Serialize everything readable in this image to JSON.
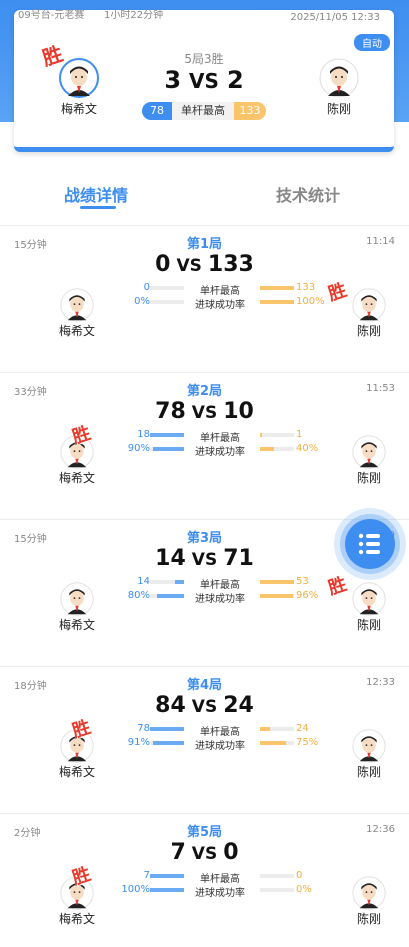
{
  "header": {
    "room": "09号台-元老赛",
    "duration": "1小时22分钟",
    "date": "2025/11/05 12:33",
    "mode_badge": "自动",
    "format": "5局3胜",
    "score_left": "3",
    "vs": "VS",
    "score_right": "2",
    "high_break_label": "单杆最高",
    "high_break_left": "78",
    "high_break_right": "133",
    "winner_mark": "胜",
    "player_left": "梅希文",
    "player_right": "陈刚"
  },
  "tabs": [
    {
      "label": "战绩详情",
      "active": true
    },
    {
      "label": "技术统计",
      "active": false
    }
  ],
  "stat_labels": {
    "high_break": "单杆最高",
    "success_rate": "进球成功率"
  },
  "rounds": [
    {
      "title": "第1局",
      "duration": "15分钟",
      "time": "11:14",
      "left_score": "0",
      "right_score": "133",
      "winner": "right",
      "left_break": "0",
      "right_break": "133",
      "left_rate": "0%",
      "right_rate": "100%"
    },
    {
      "title": "第2局",
      "duration": "33分钟",
      "time": "11:53",
      "left_score": "78",
      "right_score": "10",
      "winner": "left",
      "left_break": "18",
      "right_break": "1",
      "left_rate": "90%",
      "right_rate": "40%"
    },
    {
      "title": "第3局",
      "duration": "15分钟",
      "time": "12:09",
      "left_score": "14",
      "right_score": "71",
      "winner": "right",
      "left_break": "14",
      "right_break": "53",
      "left_rate": "80%",
      "right_rate": "96%"
    },
    {
      "title": "第4局",
      "duration": "18分钟",
      "time": "12:33",
      "left_score": "84",
      "right_score": "24",
      "winner": "left",
      "left_break": "78",
      "right_break": "24",
      "left_rate": "91%",
      "right_rate": "75%"
    },
    {
      "title": "第5局",
      "duration": "2分钟",
      "time": "12:36",
      "left_score": "7",
      "right_score": "0",
      "winner": "left",
      "left_break": "7",
      "right_break": "0",
      "left_rate": "100%",
      "right_rate": "0%"
    }
  ],
  "fab_icon": "list-menu-icon",
  "colors": {
    "accent": "#3d8ef0",
    "accent_light": "#6aabf3",
    "orange": "#f9c46a",
    "win_red": "#e83b2d"
  }
}
